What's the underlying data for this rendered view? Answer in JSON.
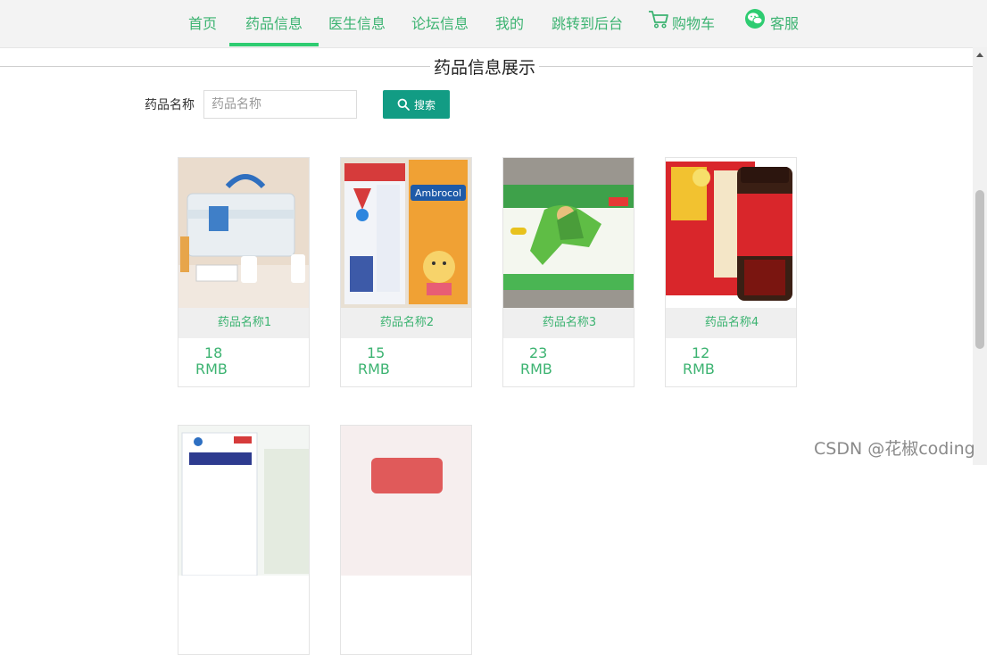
{
  "nav": {
    "items": [
      {
        "label": "首页",
        "active": false
      },
      {
        "label": "药品信息",
        "active": true
      },
      {
        "label": "医生信息",
        "active": false
      },
      {
        "label": "论坛信息",
        "active": false
      },
      {
        "label": "我的",
        "active": false
      },
      {
        "label": "跳转到后台",
        "active": false
      },
      {
        "label": "购物车",
        "icon": "cart-icon"
      },
      {
        "label": "客服",
        "icon": "wechat-icon"
      }
    ]
  },
  "section": {
    "title": "药品信息展示"
  },
  "search": {
    "label": "药品名称",
    "placeholder": "药品名称",
    "value": "",
    "button_label": "搜索",
    "button_icon": "search-icon"
  },
  "products": [
    {
      "name": "药品名称1",
      "price": "18",
      "currency": "RMB",
      "image": "medicine-box-photo"
    },
    {
      "name": "药品名称2",
      "price": "15",
      "currency": "RMB",
      "image": "ambrocol-syrup-photo"
    },
    {
      "name": "药品名称3",
      "price": "23",
      "currency": "RMB",
      "image": "green-hero-box-photo"
    },
    {
      "name": "药品名称4",
      "price": "12",
      "currency": "RMB",
      "image": "red-jar-box-photo"
    },
    {
      "name": "",
      "price": "",
      "currency": "",
      "image": "vitamin-c-box-photo"
    },
    {
      "name": "",
      "price": "",
      "currency": "",
      "image": "red-package-photo"
    }
  ],
  "watermark": "CSDN @花椒coding",
  "colors": {
    "accent": "#3cb371",
    "button": "#129c84",
    "active_bar": "#2ecc71"
  }
}
